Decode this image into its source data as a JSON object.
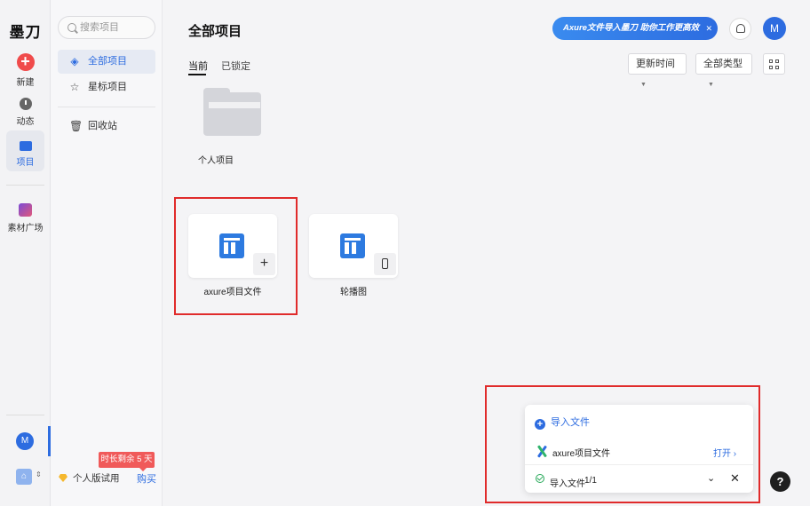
{
  "app": {
    "logo": "墨刀"
  },
  "rail": {
    "new_label": "新建",
    "activity_label": "动态",
    "projects_label": "项目",
    "materials_label": "素材广场",
    "avatar_initial": "M"
  },
  "sidebar": {
    "search_placeholder": "搜索项目",
    "items": [
      {
        "label": "全部项目",
        "icon": "layers-icon"
      },
      {
        "label": "星标项目",
        "icon": "star-icon"
      },
      {
        "label": "回收站",
        "icon": "trash-icon"
      }
    ],
    "trial_badge": "时长剩余 5 天",
    "plan_label": "个人版试用",
    "buy_label": "购买"
  },
  "header": {
    "title": "全部项目",
    "banner_text": "Axure文件导入墨刀 助你工作更高效",
    "avatar_initial": "M"
  },
  "tabs": [
    {
      "label": "当前"
    },
    {
      "label": "已锁定"
    }
  ],
  "filters": {
    "sort_label": "更新时间",
    "type_label": "全部类型"
  },
  "folder": {
    "label": "个人项目"
  },
  "projects": [
    {
      "label": "axure项目文件",
      "badge_icon": "plus-icon"
    },
    {
      "label": "轮播图",
      "badge_icon": "phone-icon"
    }
  ],
  "import_panel": {
    "title": "导入文件",
    "file_name": "axure项目文件",
    "open_label": "打开 ›",
    "status_label": "导入文件",
    "status_count": "1/1"
  },
  "colors": {
    "accent": "#2d6ce0",
    "danger": "#f04b4b",
    "highlight_box": "#e02b2b"
  }
}
